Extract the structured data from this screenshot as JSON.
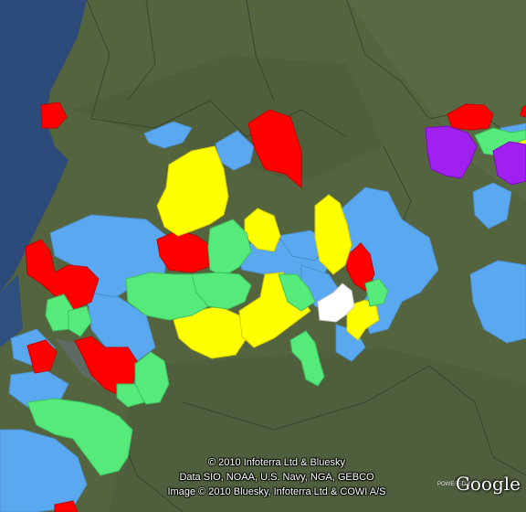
{
  "map": {
    "colors": {
      "sea": "#2c4a7a",
      "land": "#4f5f3e",
      "blue": "#5aa9f0",
      "red": "#ff0000",
      "yellow": "#ffff00",
      "green": "#55ea7a",
      "purple": "#a020f0",
      "white": "#ffffff",
      "border": "#2a3a2a"
    },
    "region_categories": [
      "blue",
      "red",
      "yellow",
      "green",
      "purple",
      "white"
    ]
  },
  "attribution": {
    "line1": "© 2010 Infoterra Ltd & Bluesky",
    "line2": "Data SIO, NOAA, U.S. Navy, NGA, GEBCO",
    "line3": "Image © 2010 Bluesky, Infoterra Ltd & COWI A/S"
  },
  "logo": {
    "text": "Google",
    "prefix": "POWERED BY"
  }
}
